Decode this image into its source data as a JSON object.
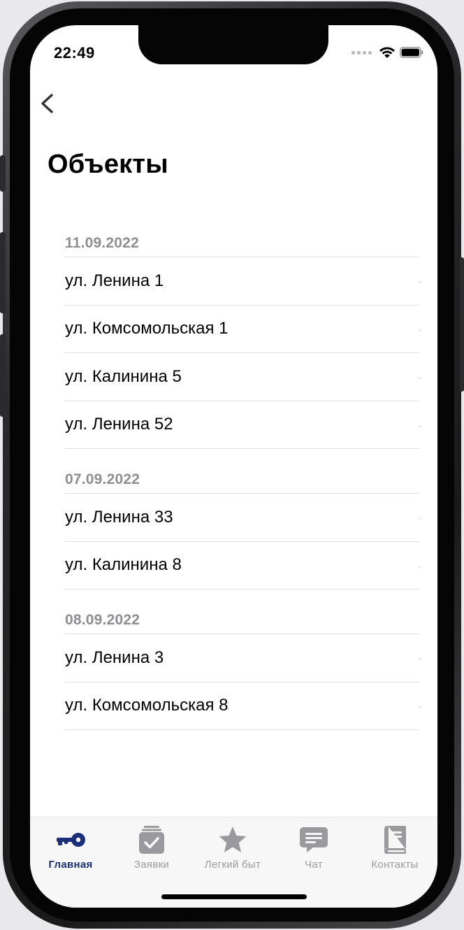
{
  "status_bar": {
    "time": "22:49"
  },
  "nav": {
    "back_label": "Back"
  },
  "page_title": "Объекты",
  "sections": [
    {
      "date": "11.09.2022",
      "items": [
        "ул. Ленина 1",
        "ул. Комсомольская 1",
        "ул. Калинина 5",
        "ул. Ленина 52"
      ]
    },
    {
      "date": "07.09.2022",
      "items": [
        "ул. Ленина 33",
        "ул. Калинина 8"
      ]
    },
    {
      "date": "08.09.2022",
      "items": [
        "ул. Ленина 3",
        "ул. Комсомольская 8"
      ]
    }
  ],
  "tabbar": {
    "tabs": [
      {
        "label": "Главная",
        "icon": "key-icon",
        "active": true
      },
      {
        "label": "Заявки",
        "icon": "checklist-icon",
        "active": false
      },
      {
        "label": "Легкий быт",
        "icon": "star-icon",
        "active": false
      },
      {
        "label": "Чат",
        "icon": "chat-bubble-icon",
        "active": false
      },
      {
        "label": "Контакты",
        "icon": "contacts-book-icon",
        "active": false
      }
    ]
  },
  "colors": {
    "accent": "#1a2f7c",
    "inactive": "#9a9a9e",
    "section_header": "#8d8d93"
  }
}
